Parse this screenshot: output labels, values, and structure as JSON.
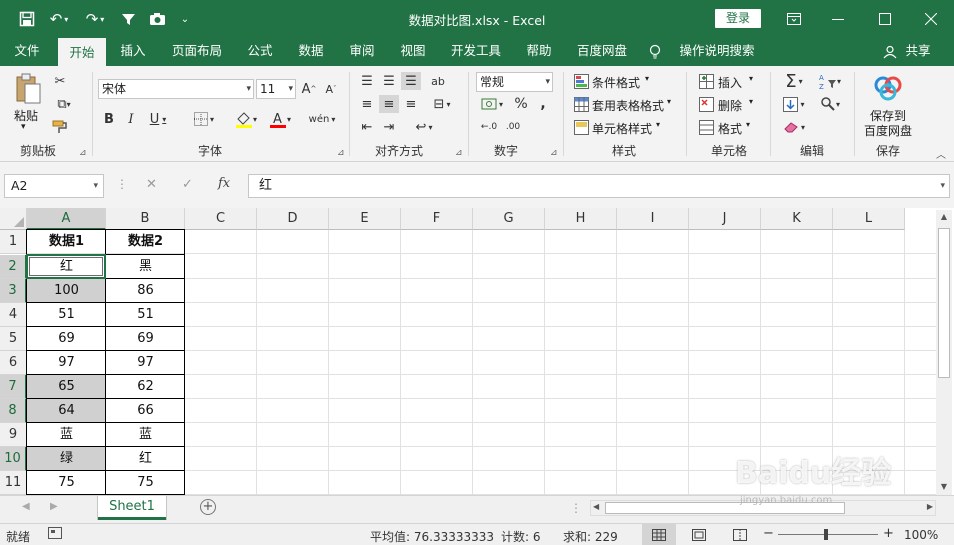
{
  "window": {
    "title": "数据对比图.xlsx  -  Excel",
    "login": "登录",
    "accent": "#217346"
  },
  "tabs": [
    "文件",
    "开始",
    "插入",
    "页面布局",
    "公式",
    "数据",
    "审阅",
    "视图",
    "开发工具",
    "帮助",
    "百度网盘",
    "操作说明搜索",
    "共享"
  ],
  "ribbon": {
    "clipboard": {
      "paste": "粘贴",
      "label": "剪贴板"
    },
    "font": {
      "name": "宋体",
      "size": "11",
      "label": "字体"
    },
    "alignment": {
      "label": "对齐方式"
    },
    "number": {
      "format": "常规",
      "label": "数字"
    },
    "styles": {
      "conditional": "条件格式",
      "table": "套用表格格式",
      "cell": "单元格样式",
      "label": "样式"
    },
    "cells": {
      "insert": "插入",
      "delete": "删除",
      "format": "格式",
      "label": "单元格"
    },
    "editing": {
      "label": "编辑"
    },
    "save": {
      "line1": "保存到",
      "line2": "百度网盘",
      "label": "保存"
    }
  },
  "formula_bar": {
    "name_box": "A2",
    "fx": "fx",
    "value": "红"
  },
  "grid": {
    "columns": [
      "A",
      "B",
      "C",
      "D",
      "E",
      "F",
      "G",
      "H",
      "I",
      "J",
      "K",
      "L"
    ],
    "rows": [
      "1",
      "2",
      "3",
      "4",
      "5",
      "6",
      "7",
      "8",
      "9",
      "10",
      "11"
    ],
    "data": [
      [
        "数据1",
        "数据2"
      ],
      [
        "红",
        "黑"
      ],
      [
        "100",
        "86"
      ],
      [
        "51",
        "51"
      ],
      [
        "69",
        "69"
      ],
      [
        "97",
        "97"
      ],
      [
        "65",
        "62"
      ],
      [
        "64",
        "66"
      ],
      [
        "蓝",
        "蓝"
      ],
      [
        "绿",
        "红"
      ],
      [
        "75",
        "75"
      ]
    ]
  },
  "sheet_tabs": [
    "Sheet1"
  ],
  "status_bar": {
    "mode": "就绪",
    "average": "平均值: 76.33333333",
    "count": "计数: 6",
    "sum": "求和: 229",
    "zoom": "100%"
  },
  "watermark": {
    "text": "Baidu经验",
    "sub": "jingyan.baidu.com"
  }
}
